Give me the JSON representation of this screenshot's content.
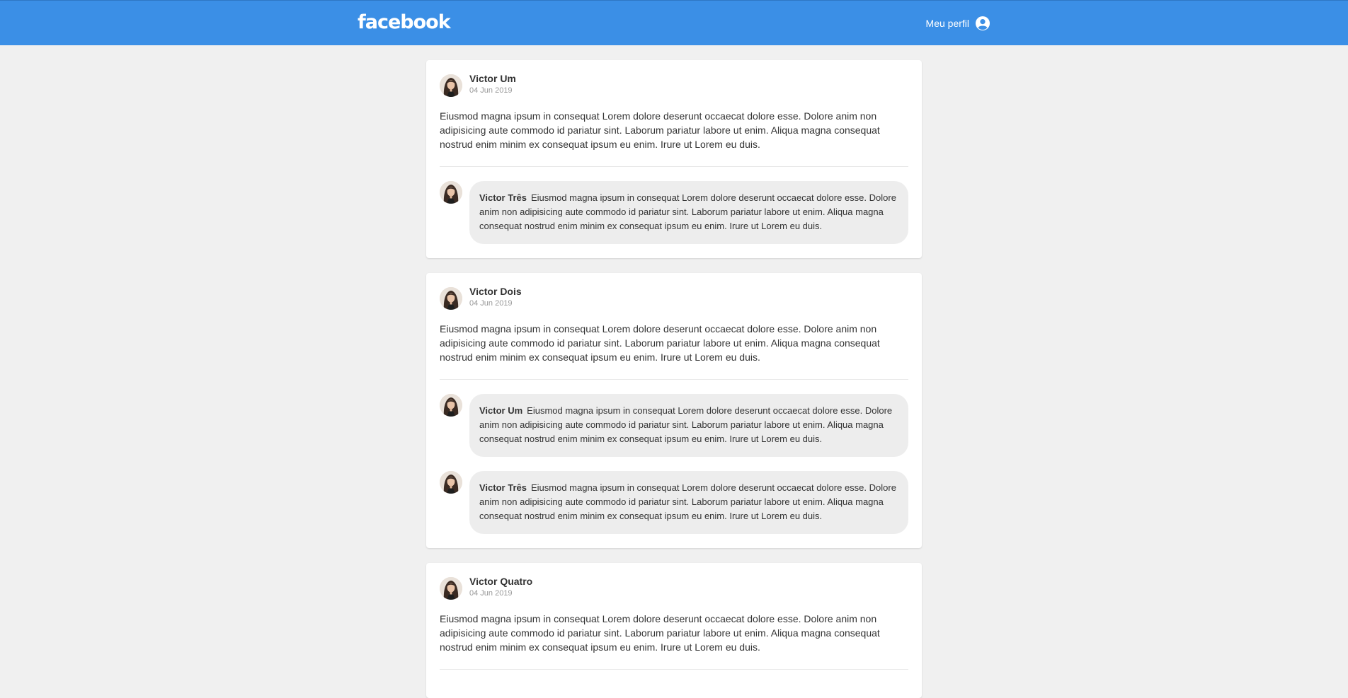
{
  "header": {
    "logo": "facebook",
    "profile_label": "Meu perfil",
    "profile_icon": "user-circle-icon",
    "bg_color": "#3b8fe6"
  },
  "posts": [
    {
      "author": "Victor Um",
      "date": "04 Jun 2019",
      "content": "Eiusmod magna ipsum in consequat Lorem dolore deserunt occaecat dolore esse. Dolore anim non adipisicing aute commodo id pariatur sint. Laborum pariatur labore ut enim. Aliqua magna consequat nostrud enim minim ex consequat ipsum eu enim. Irure ut Lorem eu duis.",
      "comments": [
        {
          "author": "Victor Três",
          "content": "Eiusmod magna ipsum in consequat Lorem dolore deserunt occaecat dolore esse. Dolore anim non adipisicing aute commodo id pariatur sint. Laborum pariatur labore ut enim. Aliqua magna consequat nostrud enim minim ex consequat ipsum eu enim. Irure ut Lorem eu duis."
        }
      ]
    },
    {
      "author": "Victor Dois",
      "date": "04 Jun 2019",
      "content": "Eiusmod magna ipsum in consequat Lorem dolore deserunt occaecat dolore esse. Dolore anim non adipisicing aute commodo id pariatur sint. Laborum pariatur labore ut enim. Aliqua magna consequat nostrud enim minim ex consequat ipsum eu enim. Irure ut Lorem eu duis.",
      "comments": [
        {
          "author": "Victor Um",
          "content": "Eiusmod magna ipsum in consequat Lorem dolore deserunt occaecat dolore esse. Dolore anim non adipisicing aute commodo id pariatur sint. Laborum pariatur labore ut enim. Aliqua magna consequat nostrud enim minim ex consequat ipsum eu enim. Irure ut Lorem eu duis."
        },
        {
          "author": "Victor Três",
          "content": "Eiusmod magna ipsum in consequat Lorem dolore deserunt occaecat dolore esse. Dolore anim non adipisicing aute commodo id pariatur sint. Laborum pariatur labore ut enim. Aliqua magna consequat nostrud enim minim ex consequat ipsum eu enim. Irure ut Lorem eu duis."
        }
      ]
    },
    {
      "author": "Victor Quatro",
      "date": "04 Jun 2019",
      "content": "Eiusmod magna ipsum in consequat Lorem dolore deserunt occaecat dolore esse. Dolore anim non adipisicing aute commodo id pariatur sint. Laborum pariatur labore ut enim. Aliqua magna consequat nostrud enim minim ex consequat ipsum eu enim. Irure ut Lorem eu duis.",
      "comments": []
    }
  ]
}
